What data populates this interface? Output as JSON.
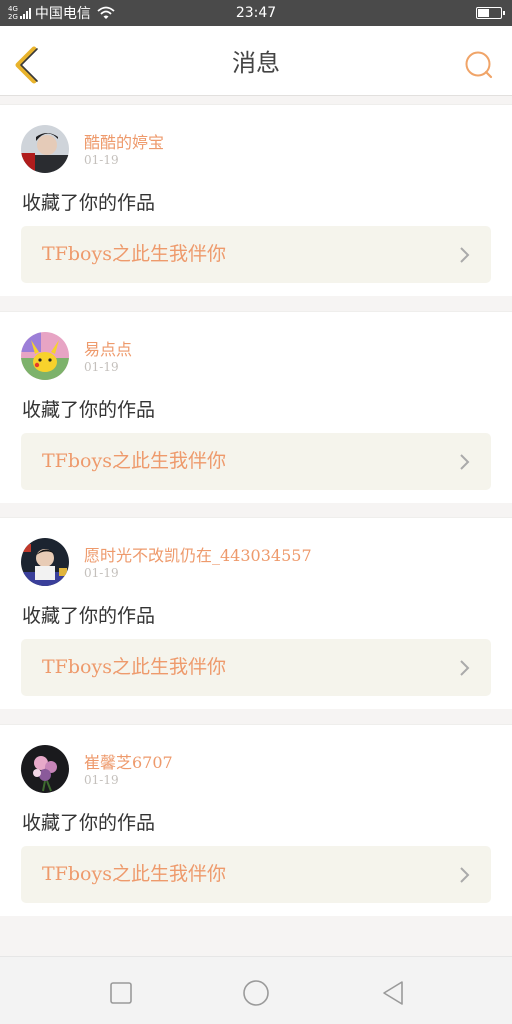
{
  "status_bar": {
    "network_tag_top": "4G",
    "network_tag_bottom": "2G",
    "carrier": "中国电信",
    "time": "23:47",
    "signal_icon": "signal-bars-icon",
    "wifi_icon": "wifi-icon",
    "battery_icon": "battery-icon",
    "battery_level": 0.55
  },
  "header": {
    "title": "消息",
    "back_icon": "chevron-left-icon",
    "search_icon": "search-icon",
    "accent_color": "#f0a468",
    "back_icon_color": "#e8b32c"
  },
  "messages": [
    {
      "username": "酷酷的婷宝",
      "date": "01-19",
      "action": "收藏了你的作品",
      "work_title": "TFboys之此生我伴你",
      "avatar_icon": "user-avatar"
    },
    {
      "username": "易点点",
      "date": "01-19",
      "action": "收藏了你的作品",
      "work_title": "TFboys之此生我伴你",
      "avatar_icon": "user-avatar"
    },
    {
      "username": "愿时光不改凯仍在_443034557",
      "date": "01-19",
      "action": "收藏了你的作品",
      "work_title": "TFboys之此生我伴你",
      "avatar_icon": "user-avatar"
    },
    {
      "username": "崔馨芝6707",
      "date": "01-19",
      "action": "收藏了你的作品",
      "work_title": "TFboys之此生我伴你",
      "avatar_icon": "user-avatar"
    }
  ],
  "colors": {
    "username": "#ee9a6c",
    "work_title": "#ee9a6c",
    "work_card_bg": "#f5f4ec",
    "page_bg": "#f6f4f3"
  },
  "nav_bar": {
    "recents_icon": "square-icon",
    "home_icon": "circle-icon",
    "back_icon": "triangle-back-icon"
  }
}
